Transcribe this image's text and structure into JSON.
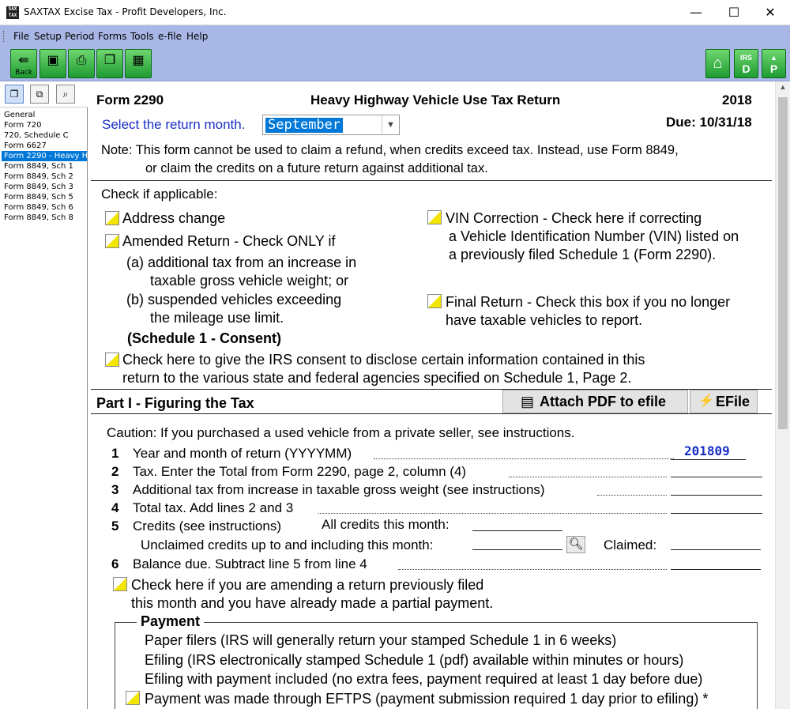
{
  "window": {
    "title": "SAXTAX Excise Tax - Profit Developers, Inc.",
    "app_icon_text": "SAX TAX",
    "minimize_glyph": "—",
    "maximize_glyph": "☐",
    "close_glyph": "✕"
  },
  "menu": [
    "File",
    "Setup",
    "Period",
    "Forms",
    "Tools",
    "e-file",
    "Help"
  ],
  "toolbar": {
    "back_label": "Back",
    "right_buttons": [
      {
        "icon": "home-icon",
        "text": ""
      },
      {
        "icon": "irs-d-icon",
        "text": "D",
        "sub": "IRS"
      },
      {
        "icon": "p-icon",
        "text": "P"
      }
    ]
  },
  "nav": {
    "items": [
      "General",
      "Form 720",
      "720, Schedule C",
      "Form 6627",
      "Form 2290 - Heavy H",
      "Form 8849, Sch 1",
      "Form 8849, Sch 2",
      "Form 8849, Sch 3",
      "Form 8849, Sch 5",
      "Form 8849, Sch 6",
      "Form 8849, Sch 8"
    ],
    "selected_index": 4
  },
  "form": {
    "form_number": "Form 2290",
    "title": "Heavy Highway Vehicle Use Tax Return",
    "year": "2018",
    "select_month_label": "Select the return month.",
    "month_value": "September",
    "due": "Due: 10/31/18",
    "note_line1": "Note:  This form cannot be used to claim a refund, when credits exceed tax.  Instead, use Form 8849,",
    "note_line2": "or claim the credits on a future return against additional tax.",
    "check_if_applicable": "Check if applicable:",
    "address_change": "Address change",
    "amended_line1": "Amended Return - Check ONLY if",
    "amended_a1": "(a) additional tax from an increase in",
    "amended_a2": "taxable gross vehicle weight; or",
    "amended_b1": "(b) suspended vehicles exceeding",
    "amended_b2": "the mileage use limit.",
    "vin_line1": "VIN Correction - Check here if correcting",
    "vin_line2": "a Vehicle Identification Number (VIN) listed on",
    "vin_line3": "a previously filed Schedule 1 (Form 2290).",
    "final_line1": "Final Return - Check this box if you no longer",
    "final_line2": "have taxable vehicles to report.",
    "consent_heading": "(Schedule 1 - Consent)",
    "consent_line1": "Check here to give the IRS consent to disclose certain information contained in this",
    "consent_line2": "return to the various state and federal agencies specified on Schedule 1, Page 2.",
    "part1_title": "Part I - Figuring the Tax",
    "attach_pdf_label": "Attach PDF to efile",
    "efile_label": "EFile",
    "caution": "Caution: If you purchased a used vehicle from a private seller, see instructions.",
    "lines": [
      {
        "num": "1",
        "text": "Year and month of return (YYYYMM)",
        "value": "201809"
      },
      {
        "num": "2",
        "text": "Tax. Enter the Total from Form 2290, page 2, column (4)",
        "value": ""
      },
      {
        "num": "3",
        "text": "Additional tax from increase in taxable gross weight (see instructions)",
        "value": ""
      },
      {
        "num": "4",
        "text": "Total tax. Add lines 2 and 3",
        "value": ""
      },
      {
        "num": "5",
        "text": "Credits (see instructions)",
        "value": ""
      },
      {
        "num": "6",
        "text": "Balance due. Subtract line 5 from line 4",
        "value": ""
      }
    ],
    "all_credits_label": "All credits this month:",
    "unclaimed_label": "Unclaimed credits up to and including this month:",
    "claimed_label": "Claimed:",
    "amend_partial_line1": "Check here if you are amending a return previously filed",
    "amend_partial_line2": "this month and you have already made a partial payment.",
    "payment": {
      "title": "Payment",
      "paper": "Paper filers (IRS will generally return your stamped Schedule 1 in 6 weeks)",
      "efiling": "Efiling (IRS electronically stamped Schedule 1 (pdf) available within minutes or hours)",
      "efiling_payment": "Efiling with payment included (no extra fees, payment required at least 1 day before due)",
      "eftps": "Payment was made through EFTPS (payment submission required 1 day prior to efiling) *"
    }
  }
}
